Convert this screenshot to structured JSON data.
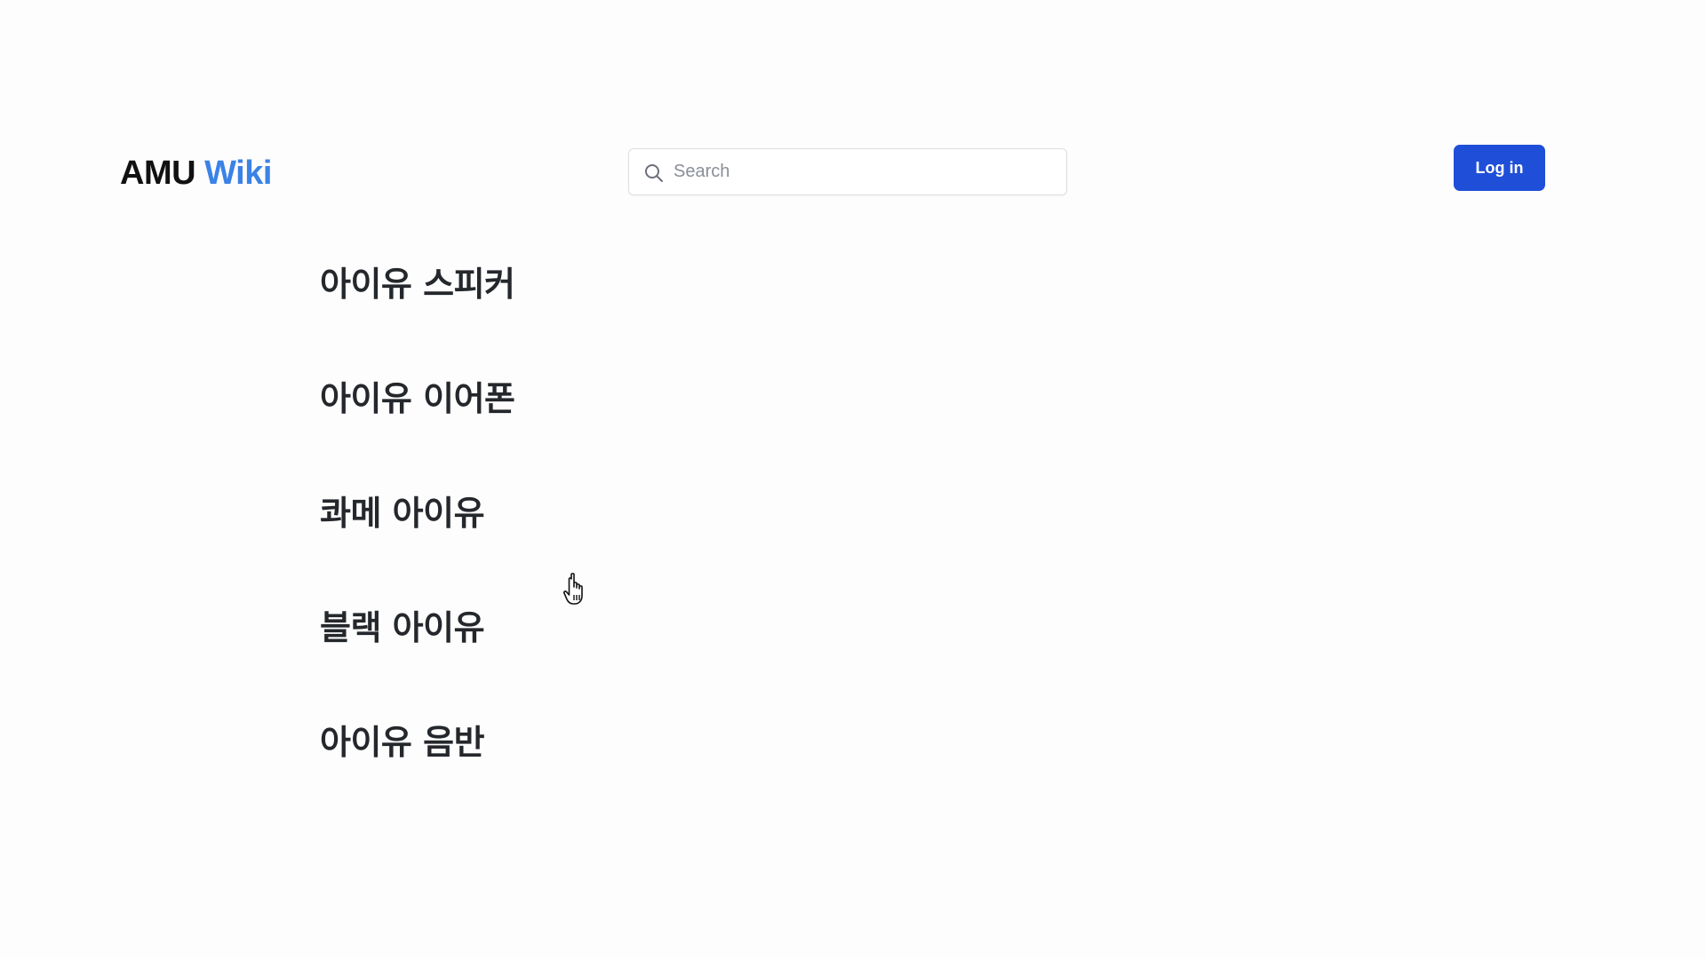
{
  "header": {
    "logo_main": "AMU",
    "logo_accent": "Wiki",
    "search_placeholder": "Search",
    "search_value": "",
    "login_label": "Log in"
  },
  "results": [
    {
      "label": "아이유 스피커"
    },
    {
      "label": "아이유 이어폰"
    },
    {
      "label": "콰메 아이유"
    },
    {
      "label": "블랙 아이유"
    },
    {
      "label": "아이유 음반"
    }
  ],
  "icons": {
    "search": "search-icon",
    "cursor": "hand-pointer-icon"
  },
  "colors": {
    "accent": "#3b82e6",
    "button": "#1f4fd8",
    "text": "#24272b"
  }
}
